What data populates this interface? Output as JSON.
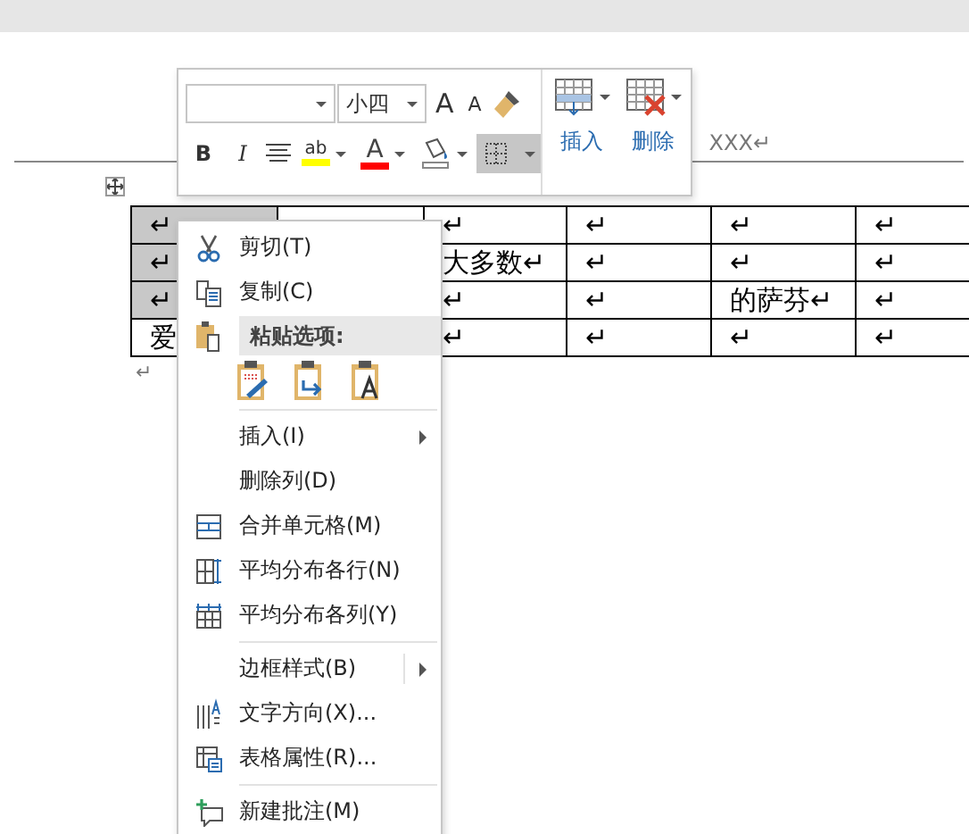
{
  "header_text": "XXX↵",
  "table": {
    "rows": [
      [
        {
          "text": "↵",
          "selected": true
        },
        {},
        {
          "text": "↵",
          "selected": false
        },
        {
          "text": "↵",
          "selected": false
        },
        {
          "text": "↵",
          "selected": false
        },
        {
          "text": "↵",
          "selected": false
        }
      ],
      [
        {
          "text": "↵",
          "selected": true
        },
        {},
        {
          "text": "大多数↵",
          "selected": false
        },
        {
          "text": "↵",
          "selected": false
        },
        {
          "text": "↵",
          "selected": false
        },
        {
          "text": "↵",
          "selected": false
        }
      ],
      [
        {
          "text": "↵",
          "selected": true
        },
        {},
        {
          "text": "↵",
          "selected": false
        },
        {
          "text": "↵",
          "selected": false
        },
        {
          "text": "的萨芬↵",
          "selected": false
        },
        {
          "text": "↵",
          "selected": false
        }
      ],
      [
        {
          "text": "爱",
          "selected": false
        },
        {},
        {
          "text": "↵",
          "selected": false
        },
        {
          "text": "↵",
          "selected": false
        },
        {
          "text": "↵",
          "selected": false
        },
        {
          "text": "↵",
          "selected": false
        }
      ]
    ]
  },
  "after_table_text": "↵",
  "toolbar": {
    "font_size": "小四",
    "grow_font": "A",
    "shrink_font": "A",
    "bold": "B",
    "italic": "I",
    "highlight": {
      "label": "ab",
      "color": "#ffff00"
    },
    "font_color": {
      "label": "A",
      "color": "#ff0000"
    },
    "borders_selected": true,
    "insert_label": "插入",
    "delete_label": "删除"
  },
  "context_menu": [
    {
      "kind": "item",
      "label": "剪切(T)",
      "has_submenu": false
    },
    {
      "kind": "item",
      "label": "复制(C)",
      "has_submenu": false
    },
    {
      "kind": "header",
      "label": "粘贴选项:"
    },
    {
      "kind": "paste_options"
    },
    {
      "kind": "separator"
    },
    {
      "kind": "item",
      "label": "插入(I)",
      "has_submenu": true
    },
    {
      "kind": "item",
      "label": "删除列(D)",
      "has_submenu": false
    },
    {
      "kind": "item",
      "label": "合并单元格(M)",
      "has_submenu": false
    },
    {
      "kind": "item",
      "label": "平均分布各行(N)",
      "has_submenu": false
    },
    {
      "kind": "item",
      "label": "平均分布各列(Y)",
      "has_submenu": false
    },
    {
      "kind": "separator"
    },
    {
      "kind": "item",
      "label": "边框样式(B)",
      "has_submenu": true
    },
    {
      "kind": "item",
      "label": "文字方向(X)...",
      "has_submenu": false
    },
    {
      "kind": "item",
      "label": "表格属性(R)...",
      "has_submenu": false
    },
    {
      "kind": "separator"
    },
    {
      "kind": "item",
      "label": "新建批注(M)",
      "has_submenu": false
    }
  ]
}
